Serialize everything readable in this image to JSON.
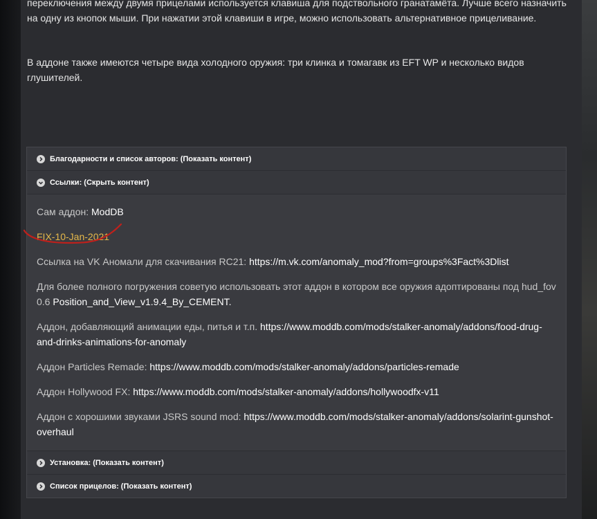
{
  "intro": {
    "p1": "переключения между двумя прицелами используется клавиша для подствольного гранатамёта. Лучше всего назначить на одну из кнопок мыши. При нажатии этой клавиши в игре, можно использовать альтернативное прицеливание.",
    "p2": "В аддоне также имеются четыре вида холодного оружия: три клинка и томагавк из EFT WP и несколько видов глушителей."
  },
  "spoilers": [
    {
      "label": "Благодарности и список авторов: (Показать контент)",
      "icon": "chevron-right-icon"
    },
    {
      "label": "Ссылки: (Скрыть контент)",
      "icon": "chevron-down-icon"
    },
    {
      "label": "Установка: (Показать контент)",
      "icon": "chevron-right-icon"
    },
    {
      "label": "Список прицелов: (Показать контент)",
      "icon": "chevron-right-icon"
    }
  ],
  "links": {
    "addon_prefix": "Сам аддон: ",
    "addon_link": "ModDB",
    "fix_link": "FIX-10-Jan-2021",
    "vk_prefix": "Ссылка на  VK Аномали для скачивания RC21: ",
    "vk_link": "https://m.vk.com/anomaly_mod?from=groups%3Fact%3Dlist",
    "hud_prefix": "Для более полного погружения советую использовать этот аддон в котором все оружия адоптированы под hud_fov 0.6 ",
    "hud_link": "Position_and_View_v1.9.4_By_CEMENT.",
    "food_prefix": "Аддон, добавляющий анимации еды, питья и т.п. ",
    "food_link": "https://www.moddb.com/mods/stalker-anomaly/addons/food-drug-and-drinks-animations-for-anomaly",
    "particles_prefix": "Аддон Particles Remade: ",
    "particles_link": "https://www.moddb.com/mods/stalker-anomaly/addons/particles-remade",
    "hollywood_prefix": "Аддон Hollywood FX: ",
    "hollywood_link": "https://www.moddb.com/mods/stalker-anomaly/addons/hollywoodfx-v11",
    "jsrs_prefix": "Аддон с хорошими звуками JSRS sound mod: ",
    "jsrs_link": "https://www.moddb.com/mods/stalker-anomaly/addons/solarint-gunshot-overhaul"
  },
  "colors": {
    "fix_link": "#e5b84a",
    "annotation": "#c0201b"
  }
}
